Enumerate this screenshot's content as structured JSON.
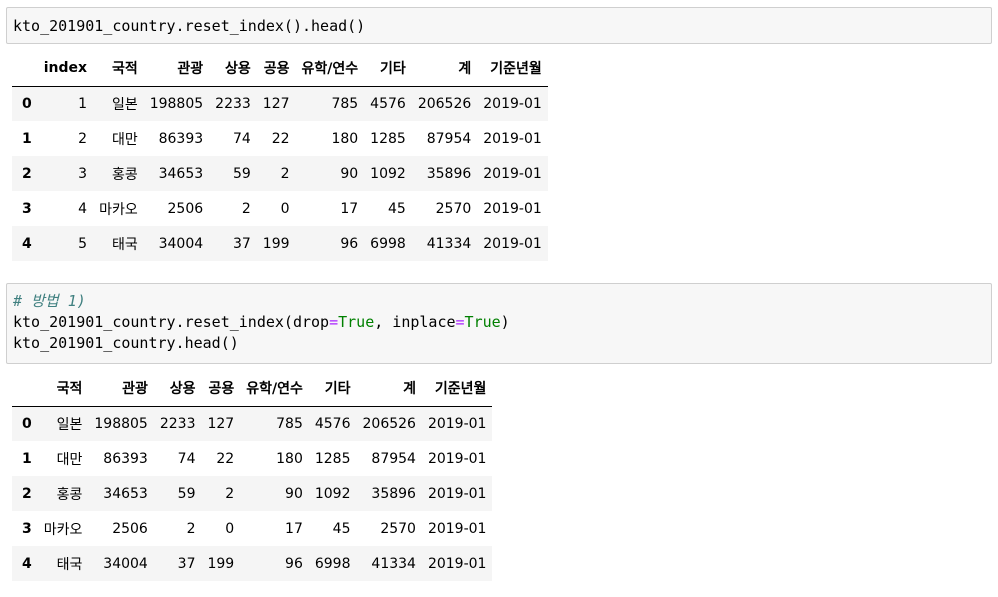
{
  "cell1": {
    "code": "kto_201901_country.reset_index().head()"
  },
  "df1": {
    "columns": [
      "",
      "index",
      "국적",
      "관광",
      "상용",
      "공용",
      "유학/연수",
      "기타",
      "계",
      "기준년월"
    ],
    "rows": [
      [
        "0",
        "1",
        "일본",
        "198805",
        "2233",
        "127",
        "785",
        "4576",
        "206526",
        "2019-01"
      ],
      [
        "1",
        "2",
        "대만",
        "86393",
        "74",
        "22",
        "180",
        "1285",
        "87954",
        "2019-01"
      ],
      [
        "2",
        "3",
        "홍콩",
        "34653",
        "59",
        "2",
        "90",
        "1092",
        "35896",
        "2019-01"
      ],
      [
        "3",
        "4",
        "마카오",
        "2506",
        "2",
        "0",
        "17",
        "45",
        "2570",
        "2019-01"
      ],
      [
        "4",
        "5",
        "태국",
        "34004",
        "37",
        "199",
        "96",
        "6998",
        "41334",
        "2019-01"
      ]
    ]
  },
  "cell2": {
    "comment": "# 방법 1)",
    "line2_a": "kto_201901_country.reset_index(drop",
    "eq": "=",
    "true_kw": "True",
    "line2_b": ", inplace",
    "line2_end": ")",
    "line3": "kto_201901_country.head()"
  },
  "df2": {
    "columns": [
      "",
      "국적",
      "관광",
      "상용",
      "공용",
      "유학/연수",
      "기타",
      "계",
      "기준년월"
    ],
    "rows": [
      [
        "0",
        "일본",
        "198805",
        "2233",
        "127",
        "785",
        "4576",
        "206526",
        "2019-01"
      ],
      [
        "1",
        "대만",
        "86393",
        "74",
        "22",
        "180",
        "1285",
        "87954",
        "2019-01"
      ],
      [
        "2",
        "홍콩",
        "34653",
        "59",
        "2",
        "90",
        "1092",
        "35896",
        "2019-01"
      ],
      [
        "3",
        "마카오",
        "2506",
        "2",
        "0",
        "17",
        "45",
        "2570",
        "2019-01"
      ],
      [
        "4",
        "태국",
        "34004",
        "37",
        "199",
        "96",
        "6998",
        "41334",
        "2019-01"
      ]
    ]
  }
}
